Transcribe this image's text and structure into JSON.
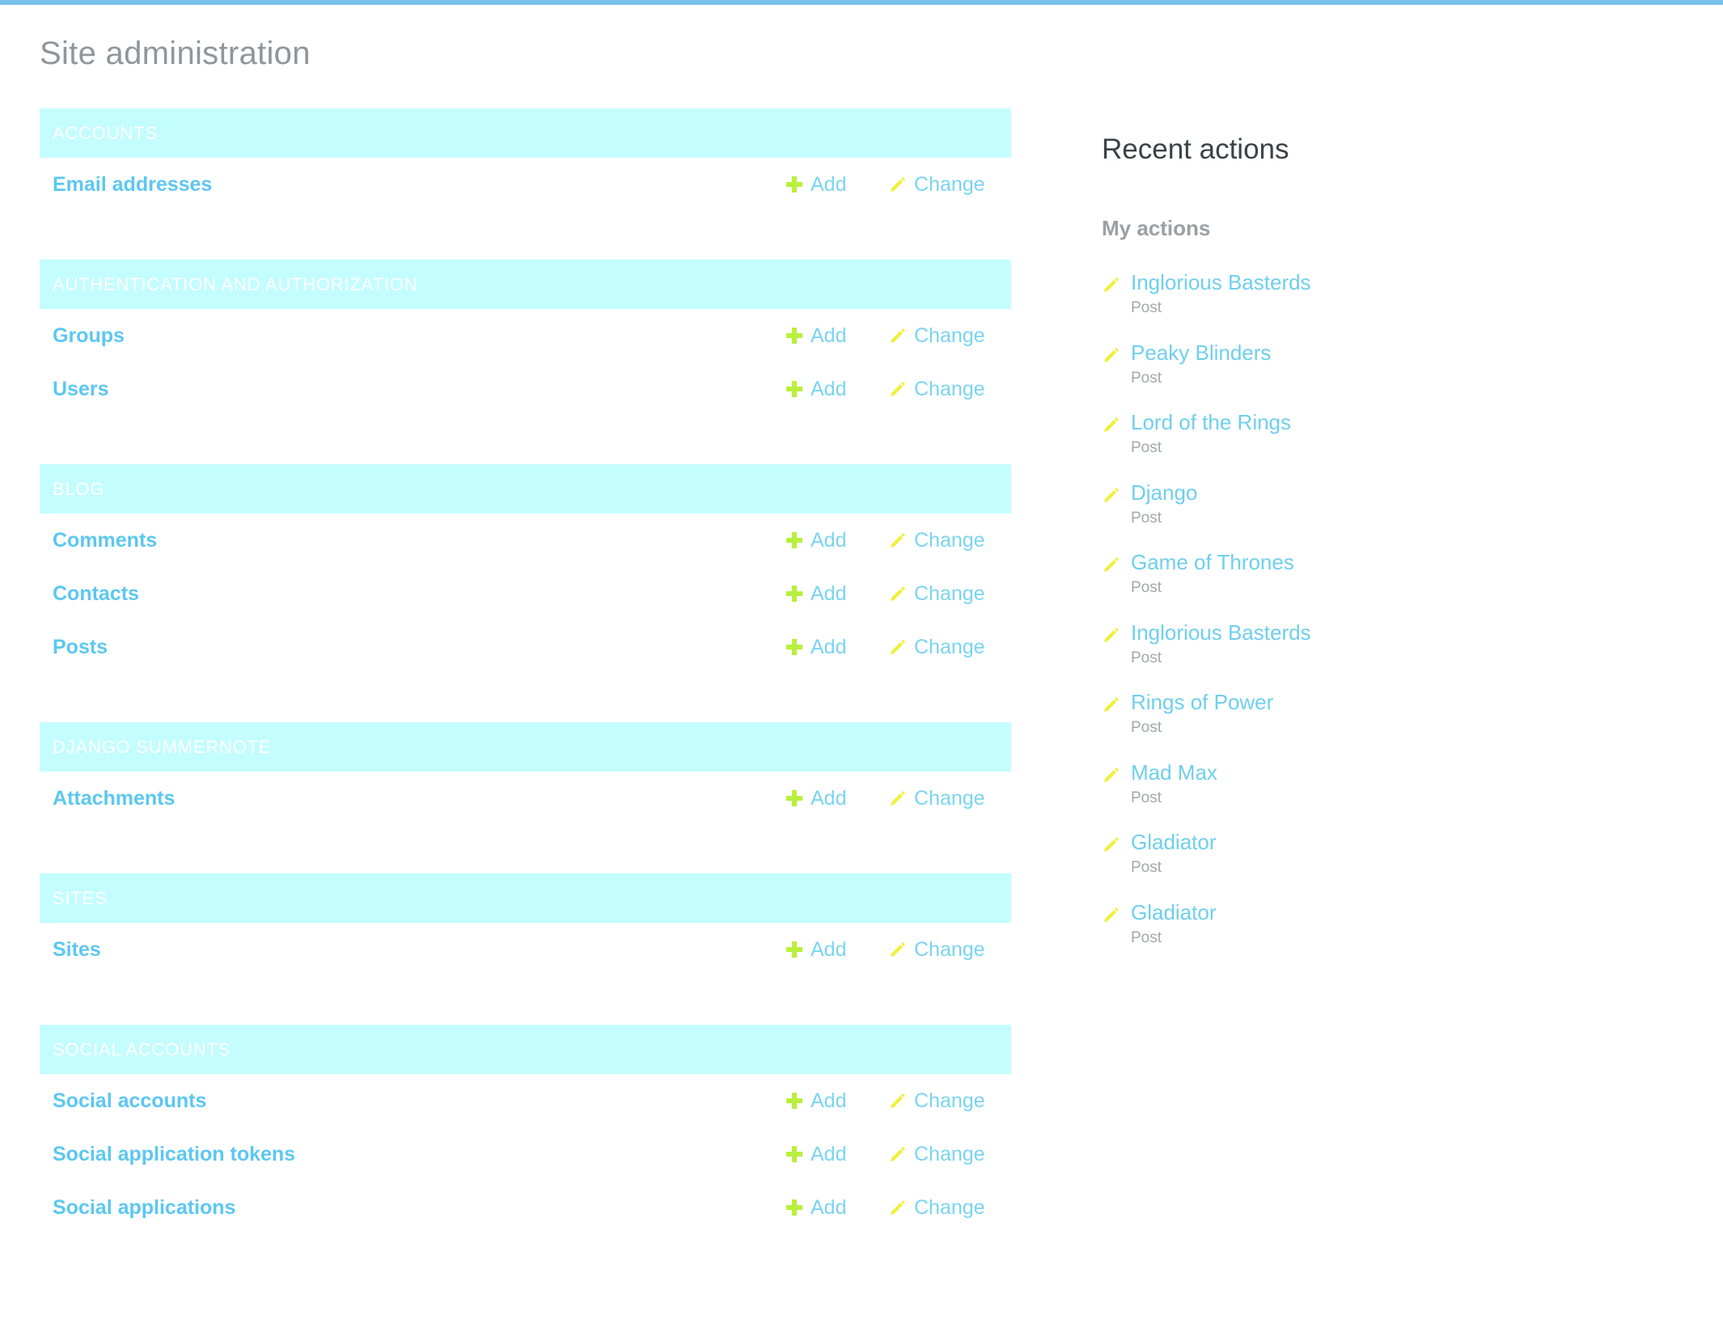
{
  "page": {
    "title": "Site administration"
  },
  "modules": [
    {
      "header": "Accounts",
      "models": [
        {
          "name": "Email addresses",
          "add": "Add",
          "change": "Change"
        }
      ]
    },
    {
      "header": "Authentication and Authorization",
      "models": [
        {
          "name": "Groups",
          "add": "Add",
          "change": "Change"
        },
        {
          "name": "Users",
          "add": "Add",
          "change": "Change"
        }
      ]
    },
    {
      "header": "Blog",
      "models": [
        {
          "name": "Comments",
          "add": "Add",
          "change": "Change"
        },
        {
          "name": "Contacts",
          "add": "Add",
          "change": "Change"
        },
        {
          "name": "Posts",
          "add": "Add",
          "change": "Change"
        }
      ]
    },
    {
      "header": "Django Summernote",
      "models": [
        {
          "name": "Attachments",
          "add": "Add",
          "change": "Change"
        }
      ]
    },
    {
      "header": "Sites",
      "models": [
        {
          "name": "Sites",
          "add": "Add",
          "change": "Change"
        }
      ]
    },
    {
      "header": "Social Accounts",
      "models": [
        {
          "name": "Social accounts",
          "add": "Add",
          "change": "Change"
        },
        {
          "name": "Social application tokens",
          "add": "Add",
          "change": "Change"
        },
        {
          "name": "Social applications",
          "add": "Add",
          "change": "Change"
        }
      ]
    }
  ],
  "recent": {
    "title": "Recent actions",
    "subtitle": "My actions",
    "actions": [
      {
        "name": "Inglorious Basterds",
        "type": "Post"
      },
      {
        "name": "Peaky Blinders",
        "type": "Post"
      },
      {
        "name": "Lord of the Rings",
        "type": "Post"
      },
      {
        "name": "Django",
        "type": "Post"
      },
      {
        "name": "Game of Thrones",
        "type": "Post"
      },
      {
        "name": "Inglorious Basterds",
        "type": "Post"
      },
      {
        "name": "Rings of Power",
        "type": "Post"
      },
      {
        "name": "Mad Max",
        "type": "Post"
      },
      {
        "name": "Gladiator",
        "type": "Post"
      },
      {
        "name": "Gladiator",
        "type": "Post"
      }
    ]
  },
  "icons": {
    "add": "plus-icon",
    "change": "pencil-icon"
  },
  "colors": {
    "topbar": "#79c0eb",
    "module_header_bg": "#c4fdfe",
    "link": "#5cc7f0",
    "plus": "#b8f03c",
    "pencil": "#f0f03c"
  }
}
